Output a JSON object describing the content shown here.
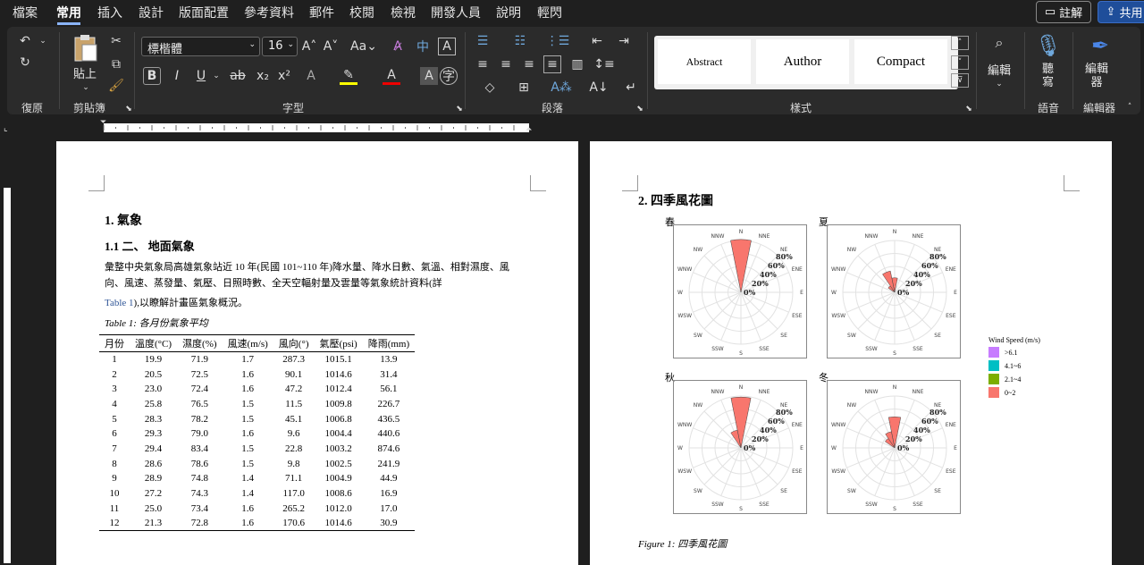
{
  "menu": {
    "items": [
      "檔案",
      "常用",
      "插入",
      "設計",
      "版面配置",
      "參考資料",
      "郵件",
      "校閱",
      "檢視",
      "開發人員",
      "說明",
      "輕閃"
    ],
    "active_index": 1,
    "comment_button": "註解",
    "share_button": "共用"
  },
  "ribbon": {
    "undo_label": "復原",
    "paste_label": "貼上",
    "clipboard_label": "剪貼簿",
    "font_name": "標楷體",
    "font_size": "16",
    "font_group_label": "字型",
    "paragraph_group_label": "段落",
    "styles_group_label": "樣式",
    "styles": [
      "Abstract",
      "Author",
      "Compact"
    ],
    "edit_label": "編輯",
    "dictate_label": "聽寫",
    "voice_group_label": "語音",
    "editor_label": "編輯器",
    "editor_group_label": "編輯器"
  },
  "page1": {
    "heading1": "1. 氣象",
    "heading2": "1.1 二、 地面氣象",
    "para_line1": "彙整中央氣象局高雄氣象站近 10 年(民國 101~110 年)降水量、降水日數、氣溫、相對濕度、風",
    "para_line2": "向、風速、蒸發量、氣壓、日照時數、全天空輻射量及雲量等氣象統計資料(詳",
    "para_line3_link": "Table 1",
    "para_line3_rest": "),以瞭解計畫區氣象概況。",
    "table_caption": "Table 1: 各月份氣象平均",
    "table": {
      "headers": [
        "月份",
        "溫度(°C)",
        "濕度(%)",
        "風速(m/s)",
        "風向(°)",
        "氣壓(psi)",
        "降雨(mm)"
      ],
      "rows": [
        [
          "1",
          "19.9",
          "71.9",
          "1.7",
          "287.3",
          "1015.1",
          "13.9"
        ],
        [
          "2",
          "20.5",
          "72.5",
          "1.6",
          "90.1",
          "1014.6",
          "31.4"
        ],
        [
          "3",
          "23.0",
          "72.4",
          "1.6",
          "47.2",
          "1012.4",
          "56.1"
        ],
        [
          "4",
          "25.8",
          "76.5",
          "1.5",
          "11.5",
          "1009.8",
          "226.7"
        ],
        [
          "5",
          "28.3",
          "78.2",
          "1.5",
          "45.1",
          "1006.8",
          "436.5"
        ],
        [
          "6",
          "29.3",
          "79.0",
          "1.6",
          "9.6",
          "1004.4",
          "440.6"
        ],
        [
          "7",
          "29.4",
          "83.4",
          "1.5",
          "22.8",
          "1003.2",
          "874.6"
        ],
        [
          "8",
          "28.6",
          "78.6",
          "1.5",
          "9.8",
          "1002.5",
          "241.9"
        ],
        [
          "9",
          "28.9",
          "74.8",
          "1.4",
          "71.1",
          "1004.9",
          "44.9"
        ],
        [
          "10",
          "27.2",
          "74.3",
          "1.4",
          "117.0",
          "1008.6",
          "16.9"
        ],
        [
          "11",
          "25.0",
          "73.4",
          "1.6",
          "265.2",
          "1012.0",
          "17.0"
        ],
        [
          "12",
          "21.3",
          "72.8",
          "1.6",
          "170.6",
          "1014.6",
          "30.9"
        ]
      ]
    }
  },
  "page2": {
    "heading": "2. 四季風花圖",
    "figure_caption": "Figure 1: 四季風花圖",
    "seasons": [
      "春",
      "夏",
      "秋",
      "冬"
    ],
    "directions": [
      "N",
      "NNE",
      "NE",
      "ENE",
      "E",
      "ESE",
      "SE",
      "SSE",
      "S",
      "SSW",
      "SW",
      "WSW",
      "W",
      "WNW",
      "NW",
      "NNW"
    ],
    "ring_labels": [
      "0%",
      "20%",
      "40%",
      "60%",
      "80%"
    ],
    "legend_title": "Wind  Speed  (m/s)",
    "legend": [
      {
        "label": ">6.1",
        "color": "#c77cff"
      },
      {
        "label": "4.1~6",
        "color": "#00bfc4"
      },
      {
        "label": "2.1~4",
        "color": "#7cae00"
      },
      {
        "label": "0~2",
        "color": "#f8766d"
      }
    ]
  }
}
